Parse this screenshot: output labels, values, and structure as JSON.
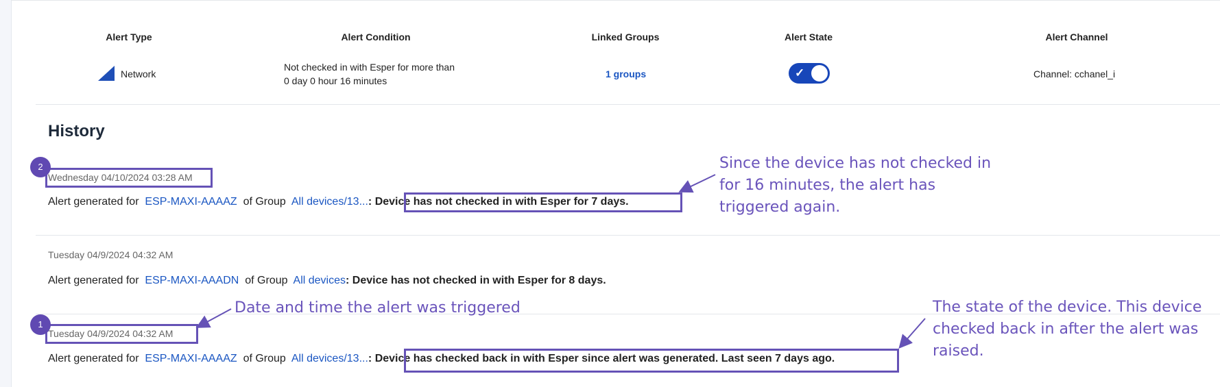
{
  "table": {
    "headers": {
      "alert_type": "Alert Type",
      "alert_condition": "Alert Condition",
      "linked_groups": "Linked Groups",
      "alert_state": "Alert State",
      "alert_channel": "Alert Channel"
    },
    "row": {
      "alert_type": "Network",
      "condition_line1": "Not checked in with Esper for more than",
      "condition_line2": "0 day 0 hour 16 minutes",
      "linked_groups": "1 groups",
      "alert_state_on": true,
      "alert_channel": "Channel: cchanel_i"
    }
  },
  "history": {
    "title": "History",
    "entries": [
      {
        "date": "Wednesday 04/10/2024 03:28 AM",
        "prefix": "Alert generated for",
        "device": "ESP-MAXI-AAAAZ",
        "group_label": "of Group",
        "group": "All devices/13...",
        "sep": ":",
        "message": "Device has not checked in with Esper for 7 days."
      },
      {
        "date": "Tuesday 04/9/2024 04:32 AM",
        "prefix": "Alert generated for",
        "device": "ESP-MAXI-AAADN",
        "group_label": "of Group",
        "group": "All devices",
        "sep": ":",
        "message": "Device has not checked in with Esper for 8 days."
      },
      {
        "date": "Tuesday 04/9/2024 04:32 AM",
        "prefix": "Alert generated for",
        "device": "ESP-MAXI-AAAAZ",
        "group_label": "of Group",
        "group": "All devices/13...",
        "sep": ":",
        "message": "Device has checked back in with Esper since alert was generated. Last seen 7 days ago."
      }
    ]
  },
  "annotations": {
    "badge_2": "2",
    "badge_1": "1",
    "retrigger_line1": "Since the device has not checked in",
    "retrigger_line2": "for 16 minutes, the alert has",
    "retrigger_line3": "triggered again.",
    "datetime": "Date and time the alert was triggered",
    "state_line1": "The state of the device. This device",
    "state_line2": "checked back in after the alert was",
    "state_line3": "raised."
  },
  "colors": {
    "annotation": "#6552b6",
    "link": "#1a56c2",
    "toggle": "#1746b9"
  }
}
